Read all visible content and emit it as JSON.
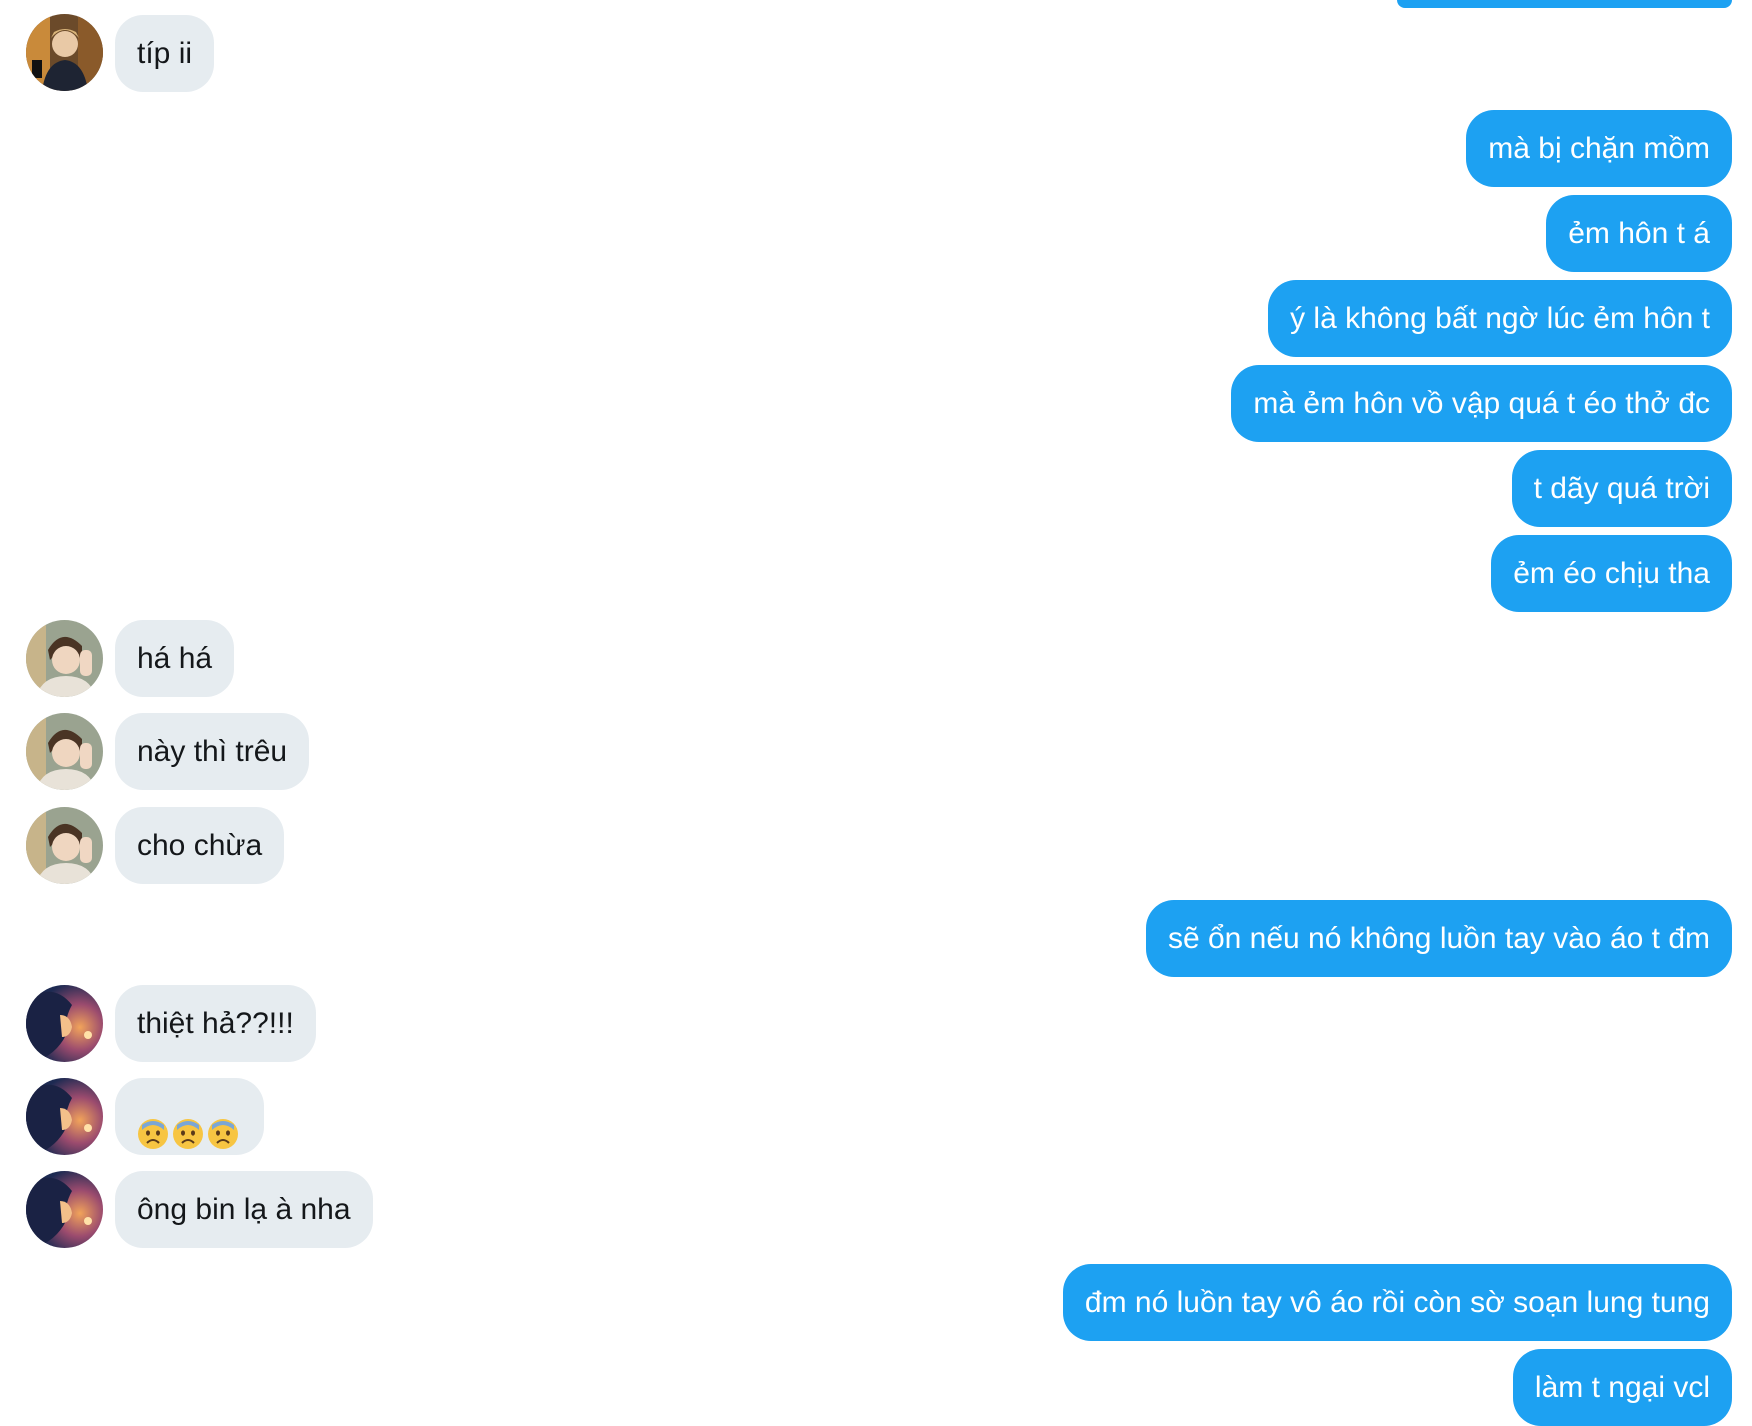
{
  "colors": {
    "sent_bubble": "#1da1f2",
    "received_bubble": "#e6ecf0",
    "sent_text": "#ffffff",
    "received_text": "#14171a"
  },
  "conversation": {
    "messages": [
      {
        "from": "contact",
        "avatar": "contact-avatar-1",
        "text": "típ ii"
      },
      {
        "from": "me",
        "text": "mà bị chặn mồm"
      },
      {
        "from": "me",
        "text": "ẻm hôn t á"
      },
      {
        "from": "me",
        "text": "ý là không bất ngờ lúc ẻm hôn t"
      },
      {
        "from": "me",
        "text": "mà ẻm hôn vồ vập quá t éo thở đc"
      },
      {
        "from": "me",
        "text": "t dãy quá trời"
      },
      {
        "from": "me",
        "text": "ẻm éo chịu tha"
      },
      {
        "from": "contact",
        "avatar": "contact-avatar-2",
        "text": "há há"
      },
      {
        "from": "contact",
        "avatar": "contact-avatar-2",
        "text": "này thì trêu"
      },
      {
        "from": "contact",
        "avatar": "contact-avatar-2",
        "text": "cho chừa"
      },
      {
        "from": "me",
        "text": "sẽ ổn nếu nó không luồn tay vào áo t đm"
      },
      {
        "from": "contact",
        "avatar": "contact-avatar-3",
        "text": "thiệt hả??!!!"
      },
      {
        "from": "contact",
        "avatar": "contact-avatar-3",
        "emoji": [
          "anxious-face-icon",
          "anxious-face-icon",
          "anxious-face-icon"
        ]
      },
      {
        "from": "contact",
        "avatar": "contact-avatar-3",
        "text": "ông bin lạ à nha"
      },
      {
        "from": "me",
        "text": "đm nó luồn tay vô áo rồi còn sờ soạn lung tung"
      },
      {
        "from": "me",
        "text": "làm t ngại vcl"
      }
    ]
  }
}
